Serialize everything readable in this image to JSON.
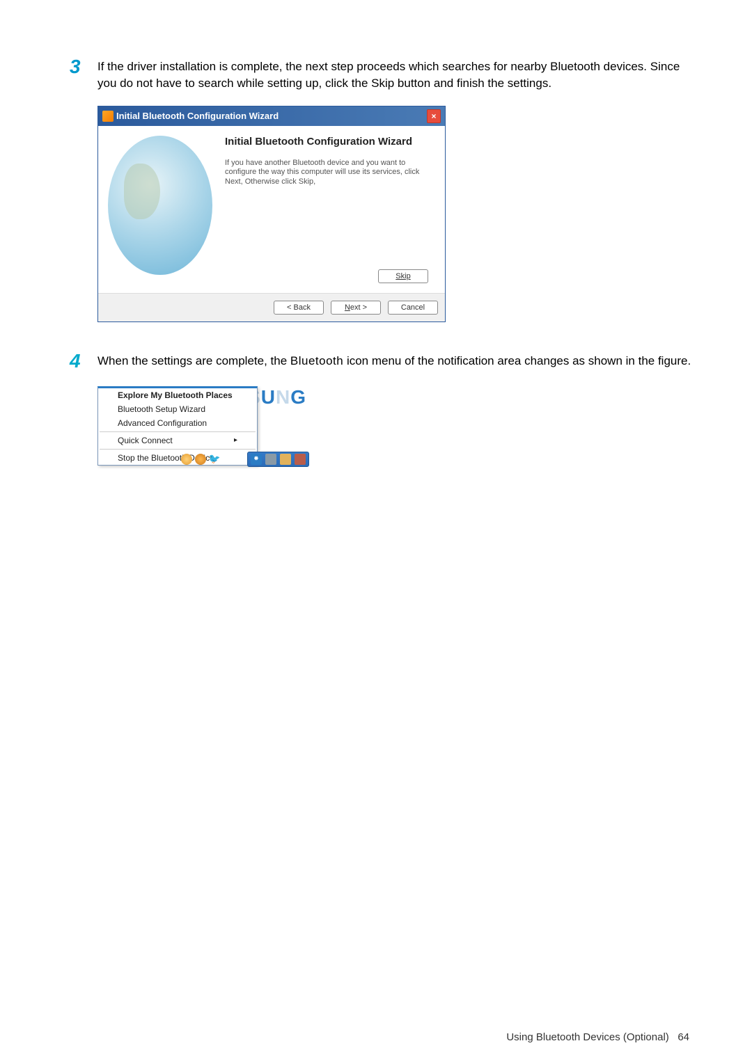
{
  "step3": {
    "number": "3",
    "text": "If the driver installation is complete, the next step proceeds which searches for nearby Blue­tooth devices. Since you do not have to search while setting up, click the Skip button and finish the settings."
  },
  "dialog": {
    "title": "Initial Bluetooth Configuration Wizard",
    "heading": "Initial Bluetooth Configuration Wizard",
    "body": "If you have another Bluetooth device and you want to configure the way this computer will use its services, click Next, Otherwise click Skip,",
    "skip": "Skip",
    "back": "< Back",
    "next": "Next >",
    "cancel": "Cancel",
    "close": "×"
  },
  "step4": {
    "number": "4",
    "text_before": "When the settings are complete, the ",
    "bluetooth_word": "Bluetooth",
    "text_after": " icon menu of the notification area changes as shown in the figure."
  },
  "menu": {
    "item1": "Explore My Bluetooth Places",
    "item2": "Bluetooth Setup Wizard",
    "item3": "Advanced Configuration",
    "item4": "Quick Connect",
    "item5": "Stop the Bluetooth Device",
    "arrow": "▸"
  },
  "logo": {
    "full": "SAMSUNG"
  },
  "footer": {
    "text": "Using Bluetooth Devices (Optional)",
    "page": "64"
  }
}
